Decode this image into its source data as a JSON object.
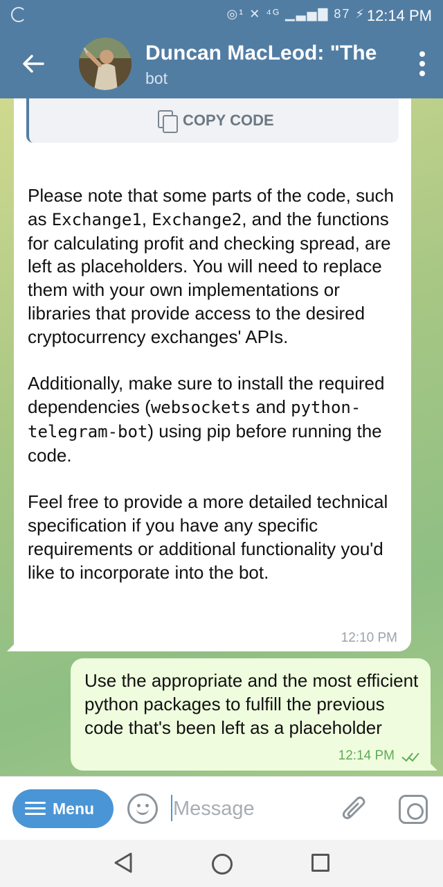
{
  "status_bar": {
    "indicators": "◎¹ ✕ ⁴ᴳ ▁▃▅▇ 87 ⚡",
    "time": "12:14 PM"
  },
  "header": {
    "title": "Duncan MacLeod: \"The",
    "subtitle": "bot",
    "icons": {
      "back": "arrow-left-icon",
      "more": "more-vert-icon"
    }
  },
  "incoming_message": {
    "copy_code_label": "COPY CODE",
    "p1_a": "Please note that some parts of the code, such as ",
    "p1_code1": "Exchange1",
    "p1_b": ", ",
    "p1_code2": "Exchange2",
    "p1_c": ", and the functions for calculating profit and checking spread, are left as placeholders. You will need to replace them with your own implementations or libraries that provide access to the desired cryptocurrency exchanges' APIs.",
    "p2_a": "Additionally, make sure to install the required dependencies (",
    "p2_code1": "websockets",
    "p2_b": " and ",
    "p2_code2": "python-telegram-bot",
    "p2_c": ") using pip before running the code.",
    "p3": "Feel free to provide a more detailed technical specification if you have any specific requirements or additional functionality you'd like to incorporate into the bot.",
    "time": "12:10 PM"
  },
  "outgoing_message": {
    "text": "Use the appropriate and the most efficient python packages to fulfill the previous code that's been left as a placeholder",
    "time": "12:14 PM",
    "status_icon": "double-check-icon"
  },
  "input_bar": {
    "menu_label": "Menu",
    "placeholder": "Message",
    "value": ""
  },
  "colors": {
    "header": "#527da3",
    "menu_button": "#4a95d6",
    "outgoing_bubble": "#effdde",
    "read_check": "#5fab55"
  }
}
